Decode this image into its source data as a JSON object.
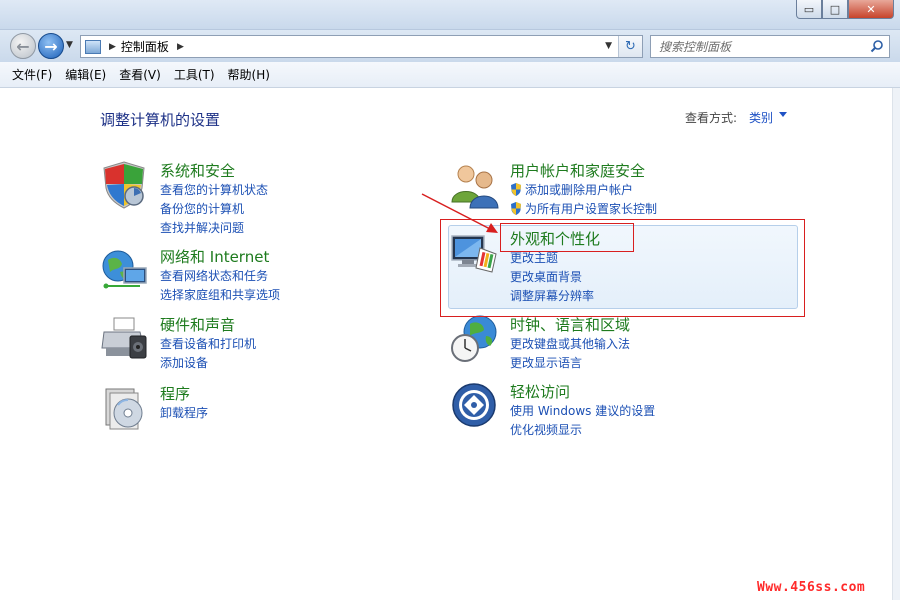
{
  "window": {
    "controls": [
      "▭",
      "□",
      "✕"
    ]
  },
  "nav": {
    "breadcrumb_root": "控制面板",
    "search_placeholder": "搜索控制面板"
  },
  "menu": [
    "文件(F)",
    "编辑(E)",
    "查看(V)",
    "工具(T)",
    "帮助(H)"
  ],
  "main": {
    "title": "调整计算机的设置",
    "view_by_label": "查看方式:",
    "view_by_value": "类别"
  },
  "categories": [
    {
      "title": "系统和安全",
      "links": [
        "查看您的计算机状态",
        "备份您的计算机",
        "查找并解决问题"
      ]
    },
    {
      "title": "网络和 Internet",
      "links": [
        "查看网络状态和任务",
        "选择家庭组和共享选项"
      ]
    },
    {
      "title": "硬件和声音",
      "links": [
        "查看设备和打印机",
        "添加设备"
      ]
    },
    {
      "title": "程序",
      "links": [
        "卸载程序"
      ]
    },
    {
      "title": "用户帐户和家庭安全",
      "links": [
        "添加或删除用户帐户",
        "为所有用户设置家长控制"
      ]
    },
    {
      "title": "外观和个性化",
      "links": [
        "更改主题",
        "更改桌面背景",
        "调整屏幕分辨率"
      ]
    },
    {
      "title": "时钟、语言和区域",
      "links": [
        "更改键盘或其他输入法",
        "更改显示语言"
      ]
    },
    {
      "title": "轻松访问",
      "links": [
        "使用 Windows 建议的设置",
        "优化视频显示"
      ]
    }
  ],
  "icons": {
    "system_security": "shield-icon",
    "network": "network-globe-icon",
    "hardware_sound": "printer-icon",
    "programs": "programs-disc-icon",
    "user_accounts": "users-icon",
    "appearance": "monitor-palette-icon",
    "clock_region": "clock-globe-icon",
    "ease_of_access": "ease-of-access-icon",
    "uac_shield": "uac-shield-icon"
  },
  "colors": {
    "category_title": "#1e7b1e",
    "link": "#1c50b4",
    "annotation": "#d81f1f",
    "watermark": "#ff2a2a"
  },
  "watermark": "Www.456ss.com"
}
